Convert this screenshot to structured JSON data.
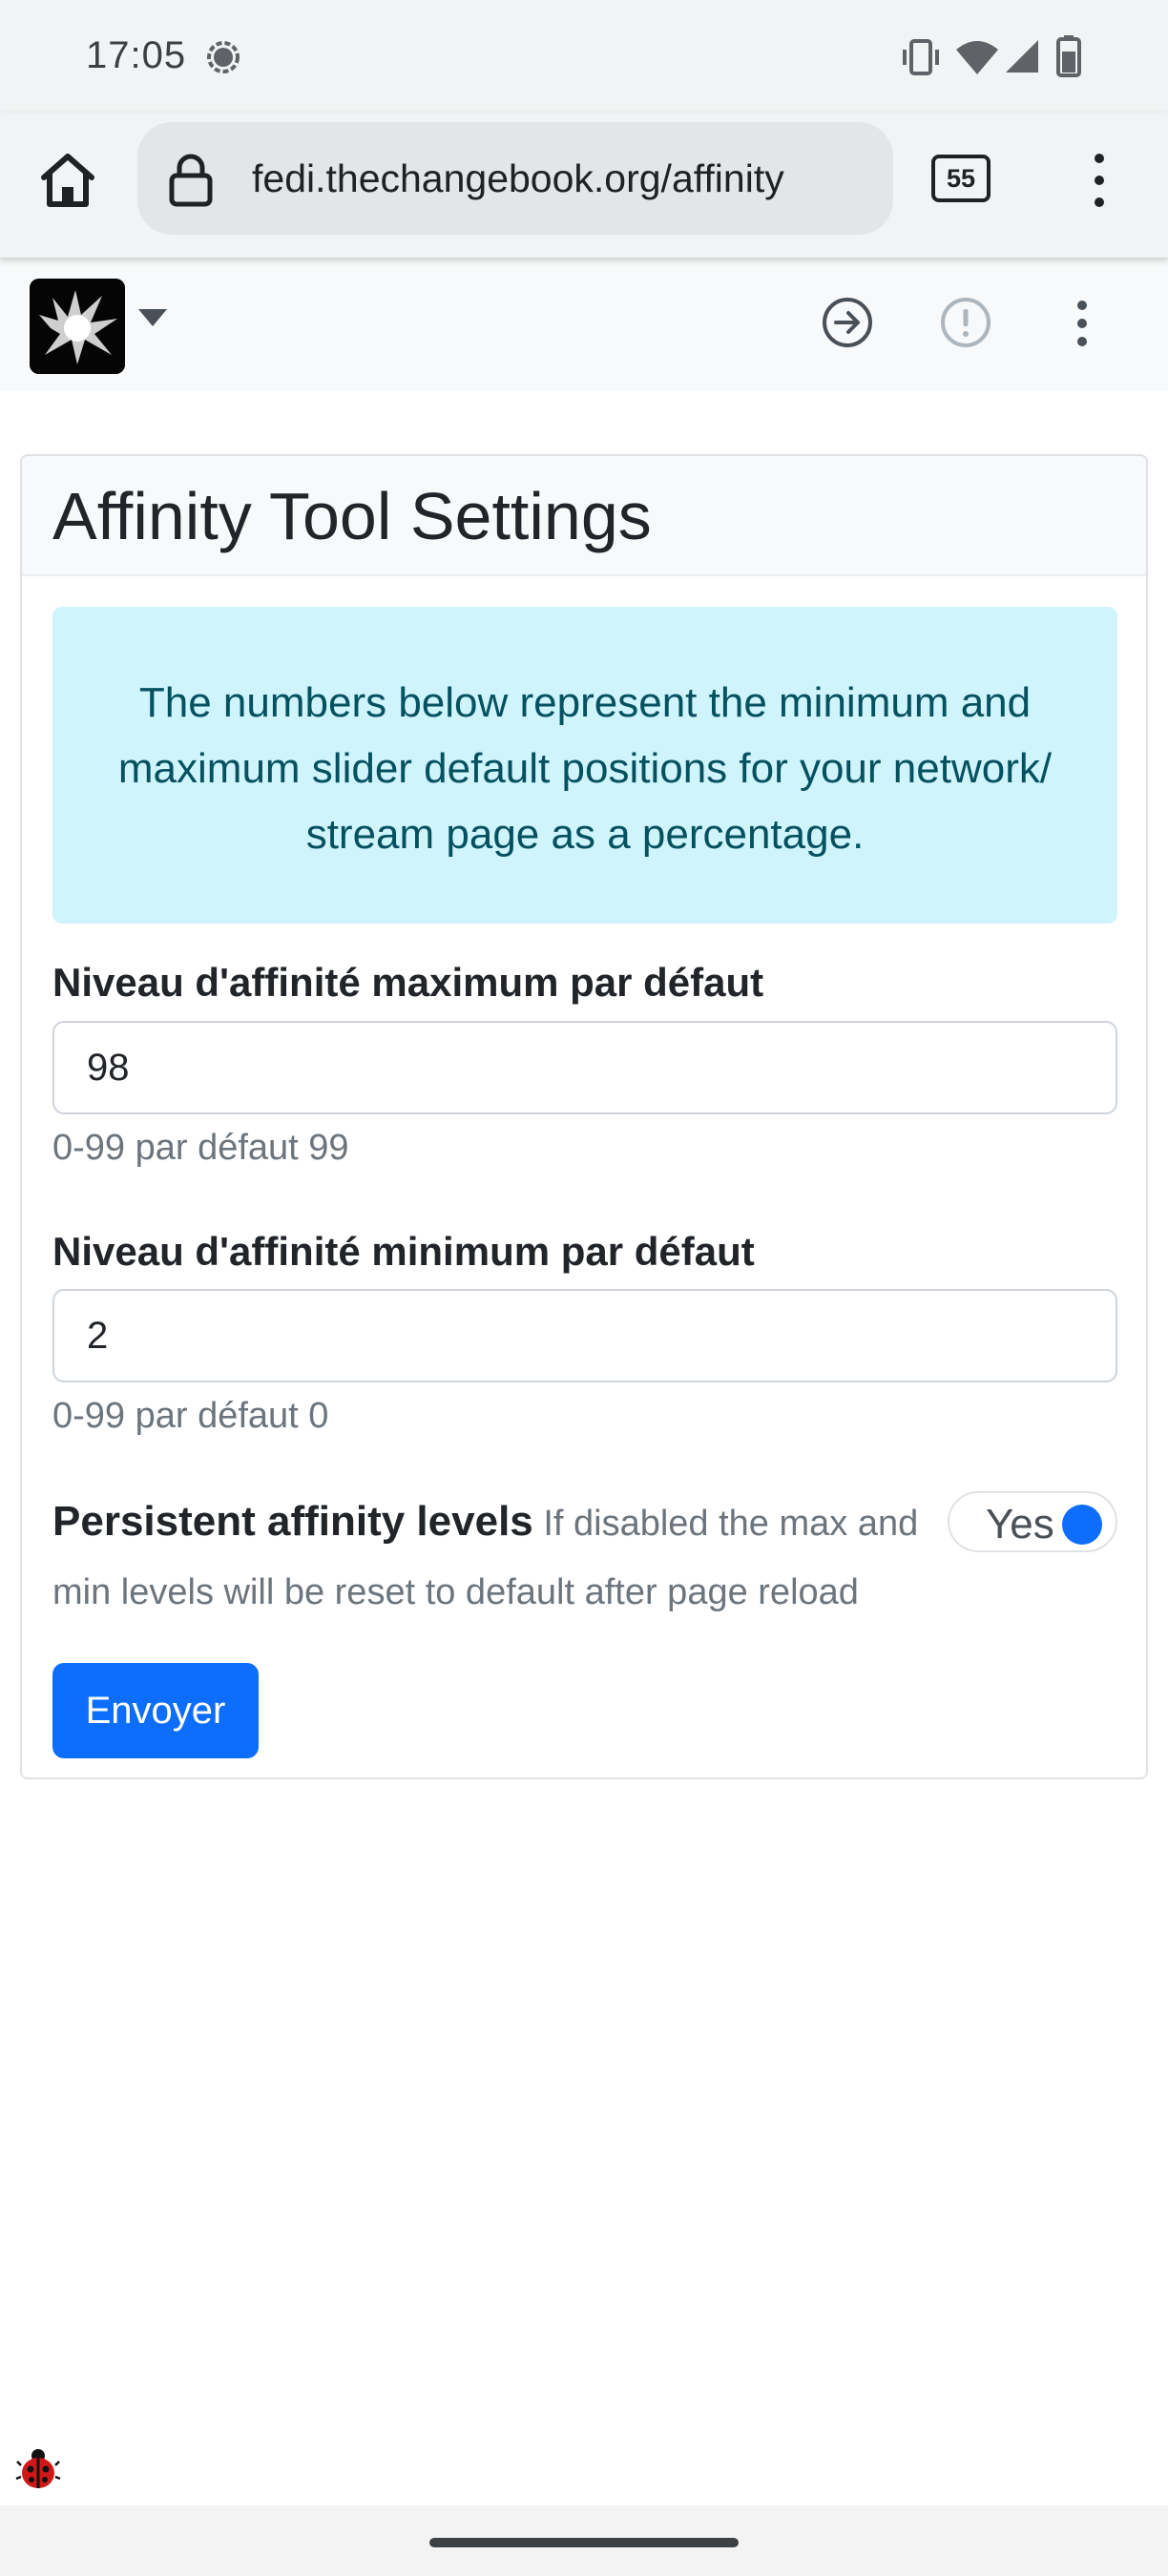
{
  "status_bar": {
    "time": "17:05",
    "icons": [
      "chat-bubble-icon",
      "vibrate-icon",
      "wifi-icon",
      "signal-icon",
      "battery-icon"
    ]
  },
  "browser": {
    "url": "fedi.thechangebook.org/affinity",
    "tab_count": "55",
    "icons": [
      "home-icon",
      "lock-icon",
      "menu-dots-icon"
    ]
  },
  "site_nav": {
    "icons": [
      "caret-down-icon",
      "login-arrow-icon",
      "notice-icon",
      "kebab-menu-icon"
    ]
  },
  "settings": {
    "title": "Affinity Tool Settings",
    "info": "The numbers below represent the minimum and maximum slider default positions for your network/ stream page as a percentage.",
    "max": {
      "label": "Niveau d'affinité maximum par défaut",
      "value": "98",
      "help": "0-99 par défaut 99"
    },
    "min": {
      "label": "Niveau d'affinité minimum par défaut",
      "value": "2",
      "help": "0-99 par défaut 0"
    },
    "persistent": {
      "label": "Persistent affinity levels",
      "description_line1": "If disabled the max and",
      "description_line2": "min levels will be reset to default after page reload",
      "toggle_label": "Yes",
      "enabled": true
    },
    "submit_label": "Envoyer"
  },
  "colors": {
    "primary": "#0d6efd",
    "alert_bg": "#cff4fc",
    "alert_text": "#055160"
  }
}
